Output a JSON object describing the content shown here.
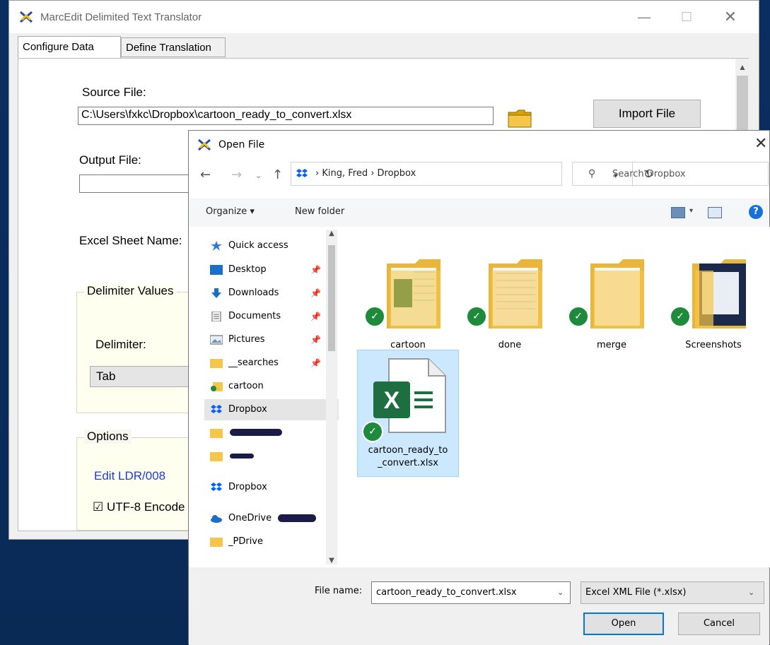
{
  "main_window": {
    "title": "MarcEdit Delimited Text Translator",
    "controls": {
      "minimize": "—",
      "maximize": "☐",
      "close": "✕"
    },
    "tabs": [
      {
        "label": "Configure Data",
        "active": true
      },
      {
        "label": "Define Translation",
        "active": false
      }
    ],
    "source_file": {
      "label": "Source File:",
      "value": "C:\\Users\\fxkc\\Dropbox\\cartoon_ready_to_convert.xlsx"
    },
    "import_button": "Import File",
    "output_file": {
      "label": "Output File:",
      "value": ""
    },
    "excel_sheet_label": "Excel Sheet Name:",
    "delimiter_group": {
      "legend": "Delimiter Values",
      "label": "Delimiter:",
      "value": "Tab"
    },
    "options_group": {
      "legend": "Options",
      "link": "Edit LDR/008",
      "checkbox": "☑ UTF-8 Encode"
    }
  },
  "dialog": {
    "title": "Open File",
    "close": "✕",
    "nav": {
      "back": "←",
      "forward": "→",
      "recent": "⌄",
      "up": "↑"
    },
    "breadcrumb": "›  King, Fred  ›  Dropbox",
    "refresh": "↻",
    "search_placeholder": "Search Dropbox",
    "toolbar": {
      "organize": "Organize ▾",
      "new_folder": "New folder",
      "view_dropdown": "▾",
      "help": "?"
    },
    "nav_pane": [
      {
        "label": "Quick access",
        "icon": "star-icon",
        "pinned": false
      },
      {
        "label": "Desktop",
        "icon": "desktop-icon",
        "pinned": true
      },
      {
        "label": "Downloads",
        "icon": "download-icon",
        "pinned": true
      },
      {
        "label": "Documents",
        "icon": "documents-icon",
        "pinned": true
      },
      {
        "label": "Pictures",
        "icon": "pictures-icon",
        "pinned": true
      },
      {
        "label": "__searches",
        "icon": "folder-icon",
        "pinned": true
      },
      {
        "label": "cartoon",
        "icon": "folder-icon",
        "pinned": false
      },
      {
        "label": "Dropbox",
        "icon": "dropbox-icon",
        "pinned": false,
        "selected": true
      },
      {
        "label": "",
        "icon": "folder-icon",
        "redacted": true
      },
      {
        "label": "",
        "icon": "folder-icon",
        "redacted": true
      },
      {
        "label": "Dropbox",
        "icon": "dropbox-icon",
        "pinned": false
      },
      {
        "label": "OneDrive",
        "icon": "cloud-icon",
        "pinned": false
      },
      {
        "label": "_PDrive",
        "icon": "folder-icon",
        "pinned": false
      }
    ],
    "pin_glyph": "📌",
    "files": [
      {
        "name": "cartoon",
        "type": "folder"
      },
      {
        "name": "done",
        "type": "folder"
      },
      {
        "name": "merge",
        "type": "folder"
      },
      {
        "name": "Screenshots",
        "type": "folder"
      },
      {
        "name": "cartoon_ready_to_convert.xlsx",
        "name_line1": "cartoon_ready_to",
        "name_line2": "_convert.xlsx",
        "type": "xlsx",
        "selected": true
      }
    ],
    "check_glyph": "✓",
    "file_name_label": "File name:",
    "file_name_value": "cartoon_ready_to_convert.xlsx",
    "file_type_value": "Excel XML File (*.xlsx)",
    "dropdown_glyph": "⌄",
    "open_button": "Open",
    "cancel_button": "Cancel"
  }
}
